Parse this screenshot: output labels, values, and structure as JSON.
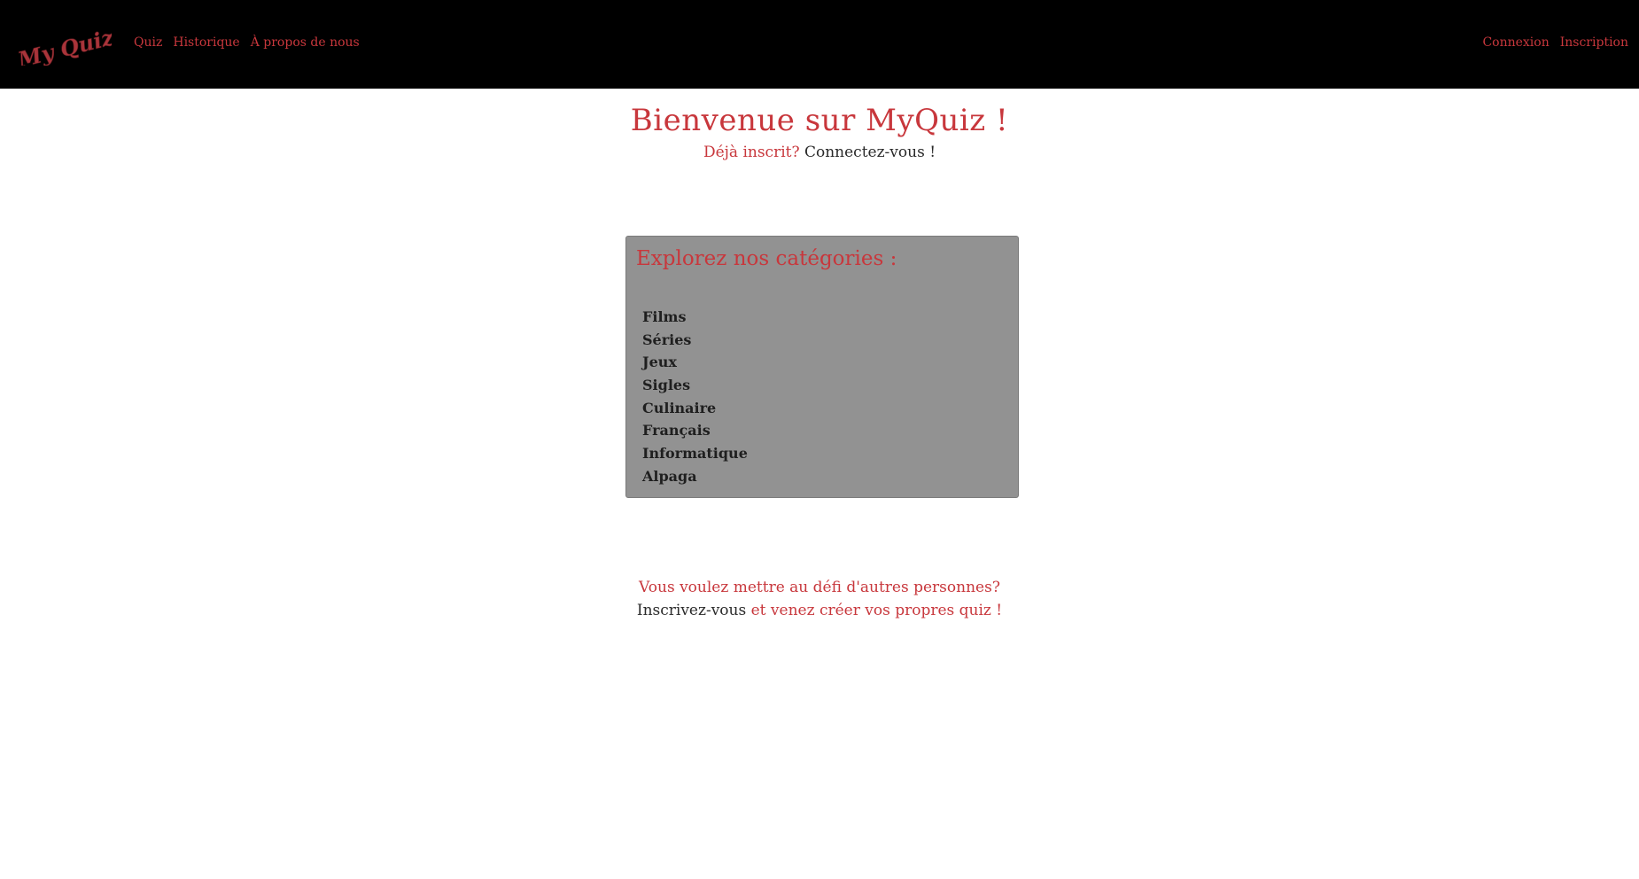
{
  "navbar": {
    "logo_text": "My Quiz",
    "left_links": [
      "Quiz",
      "Historique",
      "À propos de nous"
    ],
    "right_links": [
      "Connexion",
      "Inscription"
    ]
  },
  "hero": {
    "title": "Bienvenue sur MyQuiz !",
    "already_registered": "Déjà inscrit?",
    "login_link": "Connectez-vous !"
  },
  "categories": {
    "title": "Explorez nos catégories :",
    "items": [
      "Films",
      "Séries",
      "Jeux",
      "Sigles",
      "Culinaire",
      "Français",
      "Informatique",
      "Alpaga"
    ]
  },
  "cta": {
    "line1": "Vous voulez mettre au défi d'autres personnes?",
    "signup_link": "Inscrivez-vous",
    "line2_rest": " et venez créer vos propres quiz !"
  },
  "colors": {
    "accent": "#c8373c",
    "navbar_bg": "#000000",
    "card_bg": "#929292"
  }
}
